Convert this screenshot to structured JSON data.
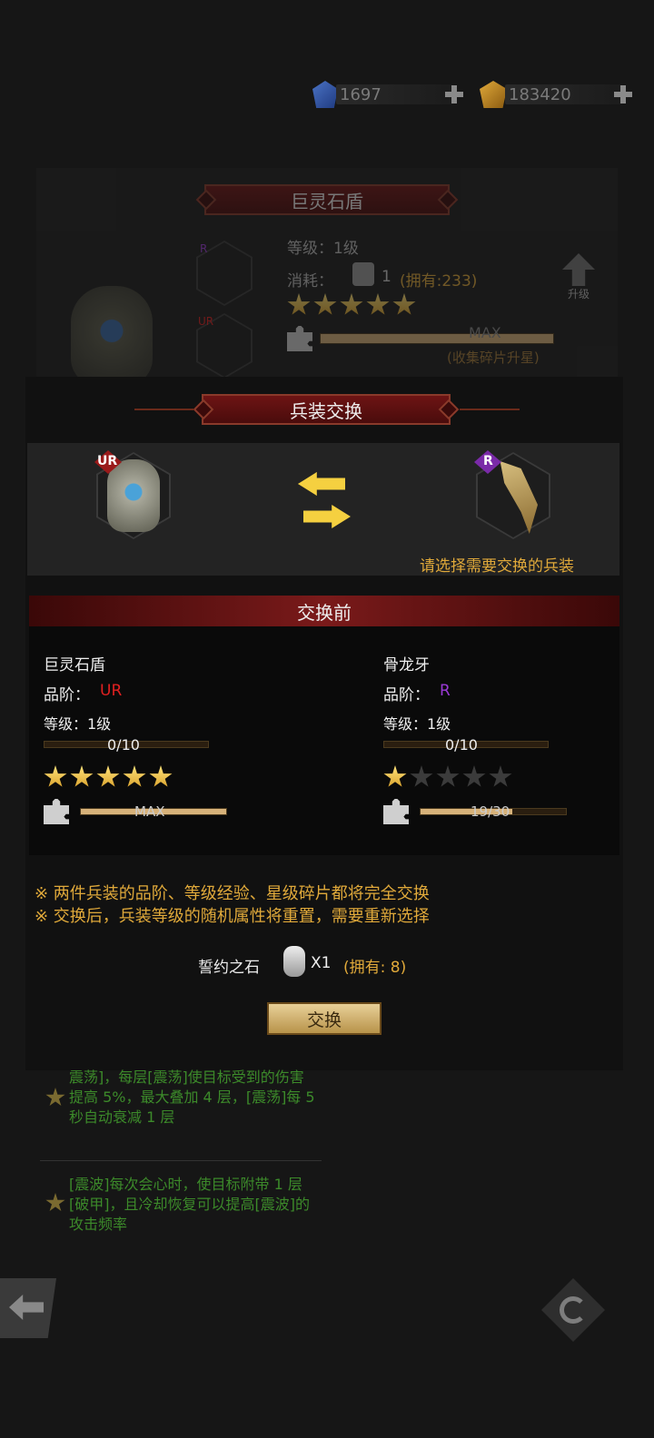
{
  "currency": {
    "gems": "1697",
    "gold": "183420"
  },
  "equip_panel": {
    "title": "巨灵石盾",
    "level_label": "等级：1级",
    "cost_label": "消耗：",
    "cost_amount": "1",
    "cost_owned": "(拥有:233)",
    "upgrade_label": "升级",
    "stars_filled": 5,
    "max_label": "MAX",
    "shard_hint": "(收集碎片升星)",
    "item1_rarity": "R",
    "item2_rarity": "UR"
  },
  "exchange": {
    "title": "兵装交换",
    "left_rarity": "UR",
    "right_rarity": "R",
    "hint": "请选择需要交换的兵装",
    "before_title": "交换前",
    "left": {
      "name": "巨灵石盾",
      "grade_label": "品阶：",
      "grade": "UR",
      "grade_color": "#e02020",
      "level": "等级：1级",
      "exp": "0/10",
      "exp_fraction": 0,
      "stars_filled": 5,
      "shard_text": "MAX",
      "shard_fraction": 1.0
    },
    "right": {
      "name": "骨龙牙",
      "grade_label": "品阶：",
      "grade": "R",
      "grade_color": "#9b3ad6",
      "level": "等级：1级",
      "exp": "0/10",
      "exp_fraction": 0,
      "stars_filled": 1,
      "shard_text": "19/30",
      "shard_fraction": 0.63
    },
    "note1": "※ 两件兵装的品阶、等级经验、星级碎片都将完全交换",
    "note2": "※ 交换后，兵装等级的随机属性将重置，需要重新选择",
    "cost_name": "誓约之石",
    "cost_qty": "X1",
    "cost_owned": "(拥有: 8)",
    "button_label": "交换"
  },
  "skills": {
    "skill1": "震荡]，每层[震荡]使目标受到的伤害提高 5%，最大叠加 4 层，[震荡]每 5 秒自动衰减 1 层",
    "skill2": "[震波]每次会心时，使目标附带 1 层[破甲]，且冷却恢复可以提高[震波]的攻击频率"
  },
  "colors": {
    "accent_gold": "#e0a93a",
    "ribbon_red": "#6d1414",
    "ur_red": "#e02020",
    "r_purple": "#9b3ad6"
  }
}
